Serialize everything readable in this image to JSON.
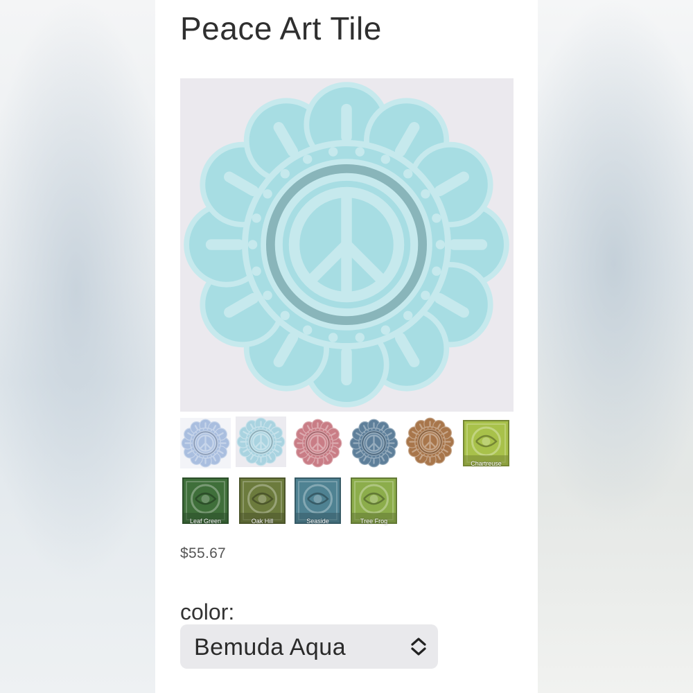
{
  "product": {
    "title": "Peace Art Tile",
    "price": "$55.67"
  },
  "thumbnails": [
    {
      "kind": "round",
      "glaze": "#a9bedf",
      "bg": "#f3f4f8",
      "label": ""
    },
    {
      "kind": "round",
      "glaze": "#a9d3e0",
      "bg": "#ecebf0",
      "label": ""
    },
    {
      "kind": "round",
      "glaze": "#c97d86",
      "bg": "#ffffff",
      "label": ""
    },
    {
      "kind": "round",
      "glaze": "#5e7f9a",
      "bg": "#ffffff",
      "label": ""
    },
    {
      "kind": "round",
      "glaze": "#a8764b",
      "bg": "#ffffff",
      "label": ""
    },
    {
      "kind": "square",
      "glaze": "#a8c14a",
      "bg": "#ffffff",
      "label": "Chartreuse"
    },
    {
      "kind": "square",
      "glaze": "#3f6f3a",
      "bg": "#ffffff",
      "label": "Leaf Green"
    },
    {
      "kind": "square",
      "glaze": "#6c7b3d",
      "bg": "#ffffff",
      "label": "Oak Hill"
    },
    {
      "kind": "square",
      "glaze": "#4f8292",
      "bg": "#ffffff",
      "label": "Seaside"
    },
    {
      "kind": "square",
      "glaze": "#8cad4b",
      "bg": "#ffffff",
      "label": "Tree Frog"
    }
  ],
  "option": {
    "label": "color:",
    "selected": "Bemuda Aqua"
  },
  "colors": {
    "main_glaze": "#a7dde3",
    "main_background": "#ebe9ee"
  }
}
